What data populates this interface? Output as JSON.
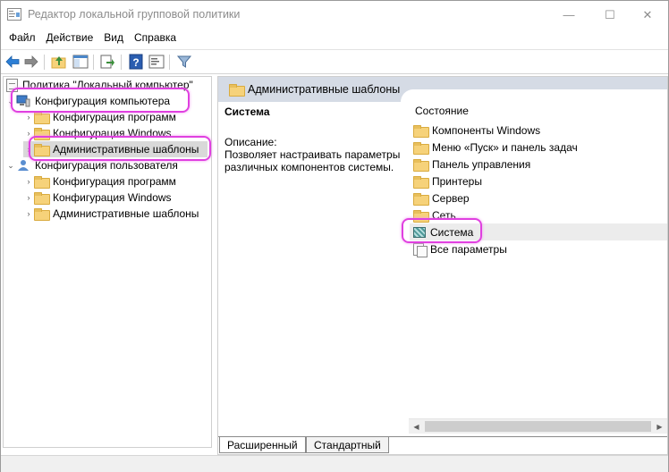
{
  "window": {
    "title": "Редактор локальной групповой политики",
    "minimize_glyph": "—",
    "maximize_glyph": "☐",
    "close_glyph": "✕"
  },
  "menu": [
    "Файл",
    "Действие",
    "Вид",
    "Справка"
  ],
  "toolbar": {
    "icons": [
      "back-icon",
      "forward-icon",
      "up-folder-icon",
      "show-hide-tree-icon",
      "export-list-icon",
      "help-icon",
      "properties-icon",
      "filter-icon"
    ]
  },
  "tree": {
    "root": "Политика \"Локальный компьютер\"",
    "computer_config": {
      "label": "Конфигурация компьютера",
      "children": [
        "Конфигурация программ",
        "Конфигурация Windows",
        "Административные шаблоны"
      ]
    },
    "user_config": {
      "label": "Конфигурация пользователя",
      "children": [
        "Конфигурация программ",
        "Конфигурация Windows",
        "Административные шаблоны"
      ]
    }
  },
  "right": {
    "header_title": "Административные шаблоны",
    "selected_title": "Система",
    "description_label": "Описание:",
    "description_text": "Позволяет настраивать параметры различных компонентов системы.",
    "column_header": "Состояние",
    "items": [
      {
        "label": "Компоненты Windows",
        "icon": "folder-icon"
      },
      {
        "label": "Меню «Пуск» и панель задач",
        "icon": "folder-icon"
      },
      {
        "label": "Панель управления",
        "icon": "folder-icon"
      },
      {
        "label": "Принтеры",
        "icon": "folder-icon"
      },
      {
        "label": "Сервер",
        "icon": "folder-icon"
      },
      {
        "label": "Сеть",
        "icon": "folder-icon"
      },
      {
        "label": "Система",
        "icon": "system-policy-icon",
        "selected": true
      },
      {
        "label": "Все параметры",
        "icon": "all-settings-icon"
      }
    ],
    "scroll_left": "◀",
    "scroll_right": "▶"
  },
  "tabs": [
    "Расширенный",
    "Стандартный"
  ],
  "colors": {
    "highlight": "#e040e0",
    "header_band": "#d5dbe5",
    "folder": "#f6d27a"
  }
}
